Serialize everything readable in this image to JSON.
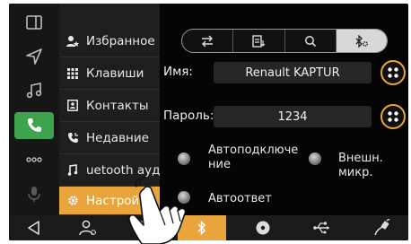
{
  "menu": {
    "items": [
      {
        "label": "Избранное"
      },
      {
        "label": "Клавиши"
      },
      {
        "label": "Контакты"
      },
      {
        "label": "Недавние"
      },
      {
        "label": "uetooth ауд"
      },
      {
        "label": "Настройки"
      }
    ]
  },
  "settings": {
    "name_label": "Имя:",
    "name_value": "Renault KAPTUR",
    "password_label": "Пароль:",
    "password_value": "1234",
    "auto_connect_line1": "Автоподключе",
    "auto_connect_line2": "ние",
    "external_mic": "Внешн. микр.",
    "auto_answer": "Автоответ"
  },
  "colors": {
    "accent": "#e9a43b",
    "phone_green": "#3da34d"
  }
}
